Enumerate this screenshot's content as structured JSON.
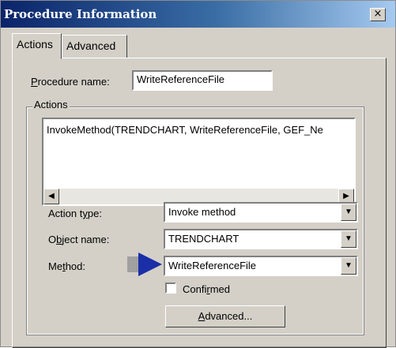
{
  "window": {
    "title": "Procedure Information",
    "close_glyph": "×"
  },
  "tabs": [
    {
      "label": "Actions",
      "selected": true
    },
    {
      "label": "Advanced",
      "selected": false
    }
  ],
  "procedure": {
    "label": "Procedure name:",
    "value": "WriteReferenceFile"
  },
  "actions_group": {
    "title": "Actions",
    "list_items": [
      "InvokeMethod(TRENDCHART, WriteReferenceFile, GEF_Ne"
    ],
    "scroll_left": "◀",
    "scroll_right": "▶"
  },
  "fields": {
    "action_type": {
      "label": "Action type:",
      "value": "Invoke method"
    },
    "object_name": {
      "label": "Object name:",
      "value": "TRENDCHART"
    },
    "method": {
      "label": "Method:",
      "value": "WriteReferenceFile"
    }
  },
  "dropdown_glyph": "▼",
  "confirmed": {
    "label": "Confirmed",
    "checked": false
  },
  "advanced_button": {
    "label": "Advanced..."
  },
  "colors": {
    "titlebar_start": "#0a246a",
    "titlebar_end": "#a6caf0",
    "arrow": "#1a2ea8",
    "dialog_face": "#d4d0c8"
  }
}
